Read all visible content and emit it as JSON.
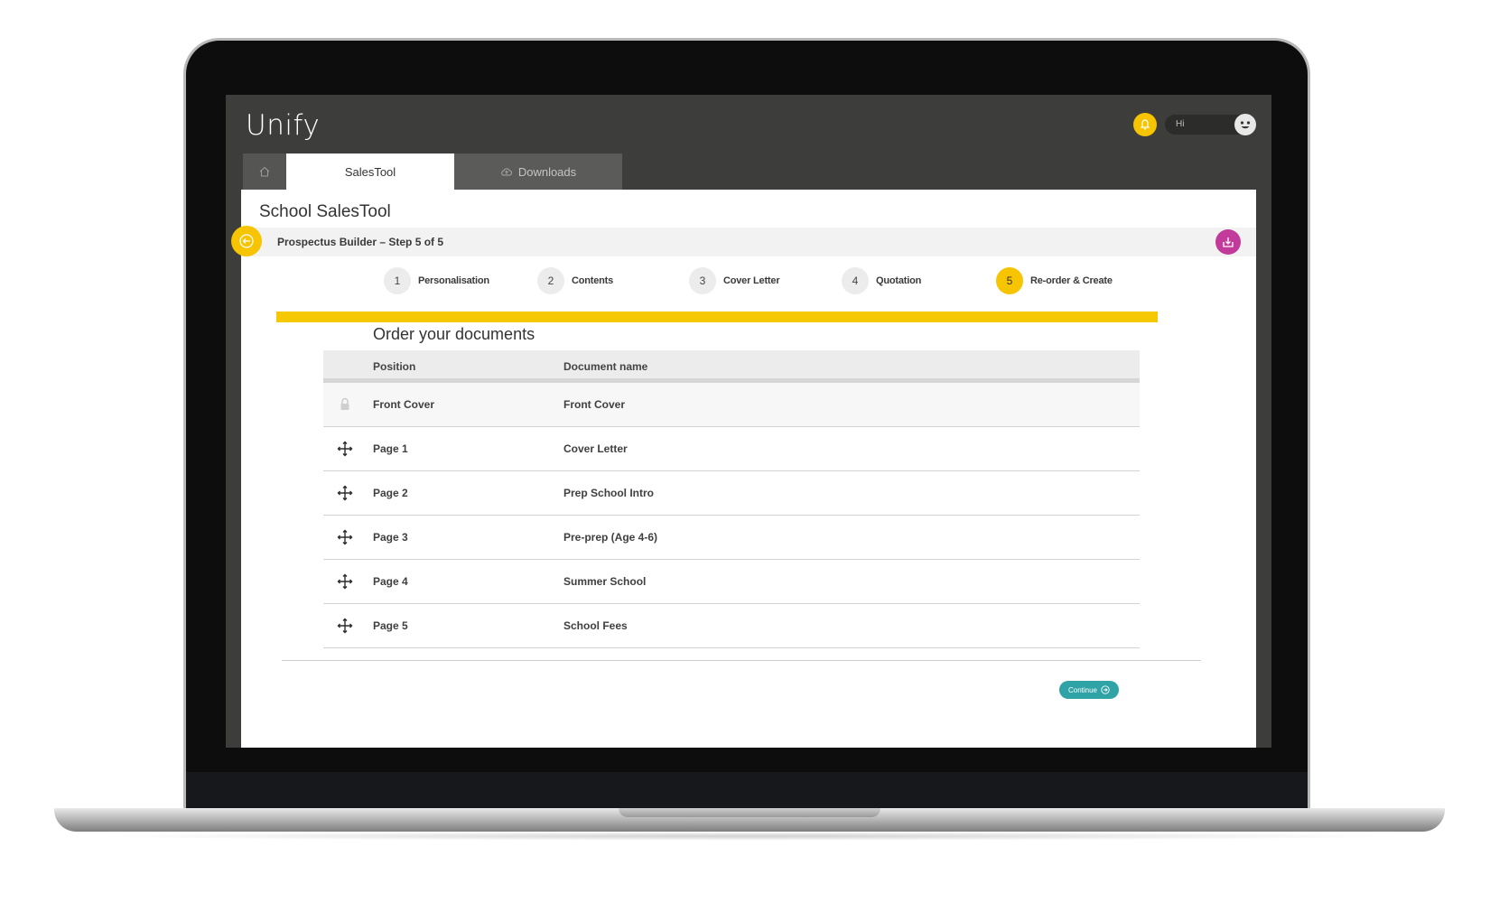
{
  "app": {
    "logo": "Unify",
    "user_greeting": "Hi",
    "accent_color": "#f6c400",
    "teal_color": "#2fa3a6",
    "magenta_color": "#c23a9a"
  },
  "tabs": [
    {
      "label": "",
      "icon": "home-icon"
    },
    {
      "label": "SalesTool",
      "active": true
    },
    {
      "label": "Downloads",
      "icon": "cloud-icon"
    }
  ],
  "page": {
    "title": "School SalesTool",
    "step_label": "Prospectus Builder – Step 5 of 5"
  },
  "steps": [
    {
      "num": "1",
      "label": "Personalisation"
    },
    {
      "num": "2",
      "label": "Contents"
    },
    {
      "num": "3",
      "label": "Cover Letter"
    },
    {
      "num": "4",
      "label": "Quotation"
    },
    {
      "num": "5",
      "label": "Re-order & Create",
      "active": true
    }
  ],
  "documents": {
    "title": "Order your documents",
    "columns": [
      "Position",
      "Document name"
    ],
    "rows": [
      {
        "position": "Front Cover",
        "name": "Front Cover",
        "locked": true
      },
      {
        "position": "Page 1",
        "name": "Cover Letter"
      },
      {
        "position": "Page 2",
        "name": "Prep School Intro"
      },
      {
        "position": "Page 3",
        "name": "Pre-prep (Age 4-6)"
      },
      {
        "position": "Page 4",
        "name": "Summer School"
      },
      {
        "position": "Page 5",
        "name": "School Fees"
      }
    ]
  },
  "actions": {
    "continue_label": "Continue"
  }
}
